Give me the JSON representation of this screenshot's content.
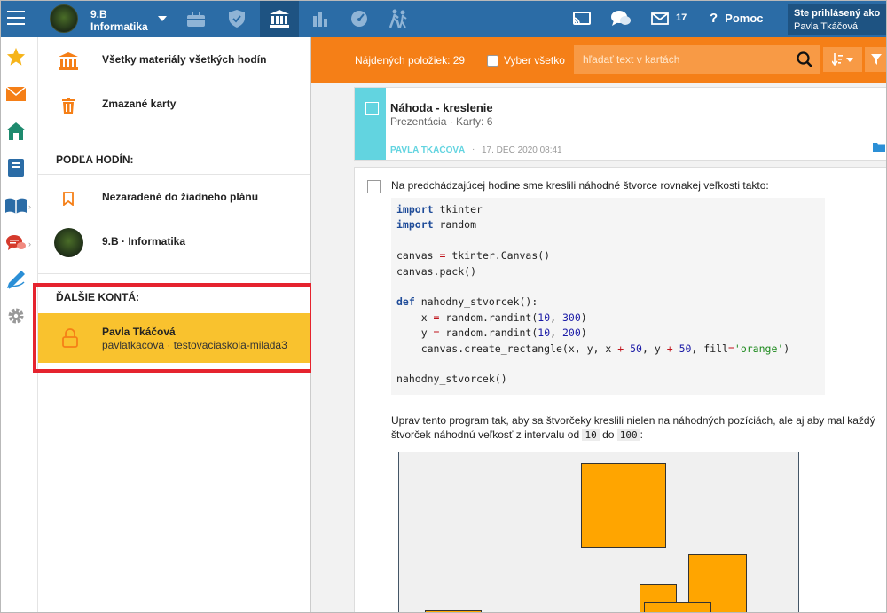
{
  "topbar": {
    "class_line1": "9.B",
    "class_line2": "Informatika",
    "messages_count": "17",
    "help_label": "Pomoc",
    "login_line1": "Ste prihlásený ako",
    "login_line2": "Pavla Tkáčová",
    "accent_color": "#2b6ca6"
  },
  "menu": {
    "all_materials": "Všetky materiály všetkých hodín",
    "deleted_cards": "Zmazané karty",
    "by_lessons_header": "PODĽA HODÍN:",
    "unassigned": "Nezaradené do žiadneho plánu",
    "class_item": "9.B · Informatika",
    "other_accounts_header": "ĎALŠIE KONTÁ:",
    "account_name": "Pavla Tkáčová",
    "account_sub": "pavlatkacova · testovaciaskola-milada3"
  },
  "filterbar": {
    "found_label": "Nájdených položiek: 29",
    "select_all_label": "Vyber všetko",
    "search_placeholder": "hľadať text v kartách",
    "bar_color": "#f57f17"
  },
  "card": {
    "title": "Náhoda - kreslenie",
    "meta": "Prezentácia · Karty: 6",
    "author": "PAVLA TKÁČOVÁ",
    "separator": "·",
    "date": "17. DEC 2020 08:41"
  },
  "doc": {
    "intro": "Na predchádzajúcej hodine sme kreslili náhodné štvorce rovnakej veľkosti takto:",
    "task_text": "Uprav tento program tak, aby sa štvorčeky kreslili nielen na náhodných pozíciách, ale aj aby mal každý štvorček náhodnú veľkosť z intervalu od",
    "task_from": "10",
    "task_and": "do",
    "task_to": "100",
    "task_end": ":"
  },
  "code": {
    "l1a": "import",
    "l1b": " tkinter",
    "l2a": "import",
    "l2b": " random",
    "l4a": "canvas ",
    "l4b": "=",
    "l4c": " tkinter.Canvas()",
    "l5": "canvas.pack()",
    "l7a": "def",
    "l7b": " nahodny_stvorcek():",
    "l8a": "    x ",
    "l8b": "=",
    "l8c": " random.randint(",
    "l8d": "10",
    "l8e": ", ",
    "l8f": "300",
    "l8g": ")",
    "l9a": "    y ",
    "l9b": "=",
    "l9c": " random.randint(",
    "l9d": "10",
    "l9e": ", ",
    "l9f": "200",
    "l9g": ")",
    "l10a": "    canvas.create_rectangle(x, y, x ",
    "l10b": "+",
    "l10c": " ",
    "l10d": "50",
    "l10e": ", y ",
    "l10f": "+",
    "l10g": " ",
    "l10h": "50",
    "l10i": ", fill",
    "l10j": "=",
    "l10k": "'orange'",
    "l10l": ")",
    "l12": "nahodny_stvorcek()"
  },
  "highlight_color": "#e5232e"
}
